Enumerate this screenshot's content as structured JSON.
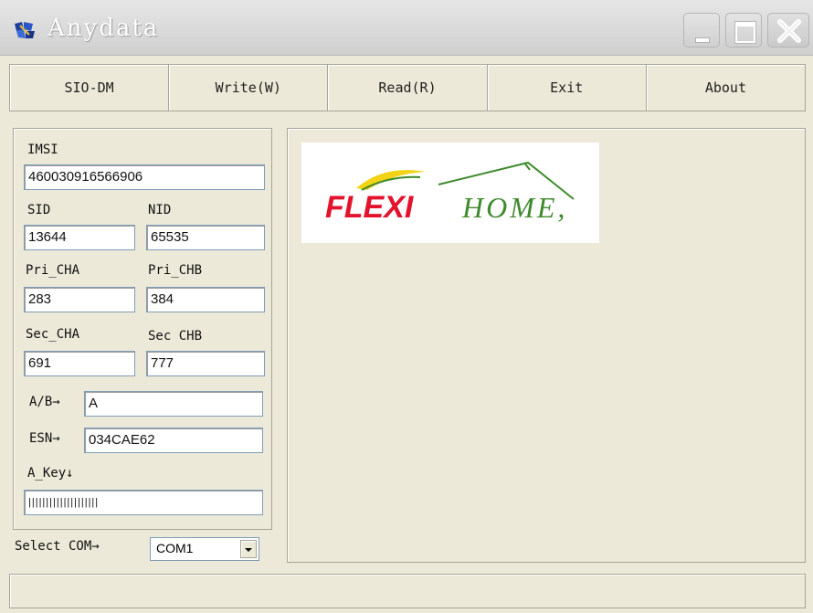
{
  "window": {
    "title": "Anydata"
  },
  "toolbar": {
    "buttons": [
      "SIO-DM",
      "Write(W)",
      "Read(R)",
      "Exit",
      "About"
    ]
  },
  "form": {
    "imsi": {
      "label": "IMSI",
      "value": "460030916566906"
    },
    "sid": {
      "label": "SID",
      "value": "13644"
    },
    "nid": {
      "label": "NID",
      "value": "65535"
    },
    "pri_cha": {
      "label": "Pri_CHA",
      "value": "283"
    },
    "pri_chb": {
      "label": "Pri_CHB",
      "value": "384"
    },
    "sec_cha": {
      "label": "Sec_CHA",
      "value": "691"
    },
    "sec_chb": {
      "label": "Sec CHB",
      "value": "777"
    },
    "ab": {
      "label": "A/B→",
      "value": "A"
    },
    "esn": {
      "label": "ESN→",
      "value": "034CAE62"
    },
    "a_key": {
      "label": "A_Key↓",
      "value": "||||||||||||||||||||"
    },
    "select_com": {
      "label": "Select COM→",
      "value": "COM1"
    }
  },
  "logo": {
    "flexi": "FLEXI",
    "home": "HOME,"
  },
  "status": {
    "text": ""
  },
  "colors": {
    "logo_red": "#e3132b",
    "logo_green": "#3e8a2c",
    "logo_yellow": "#f2d315"
  }
}
